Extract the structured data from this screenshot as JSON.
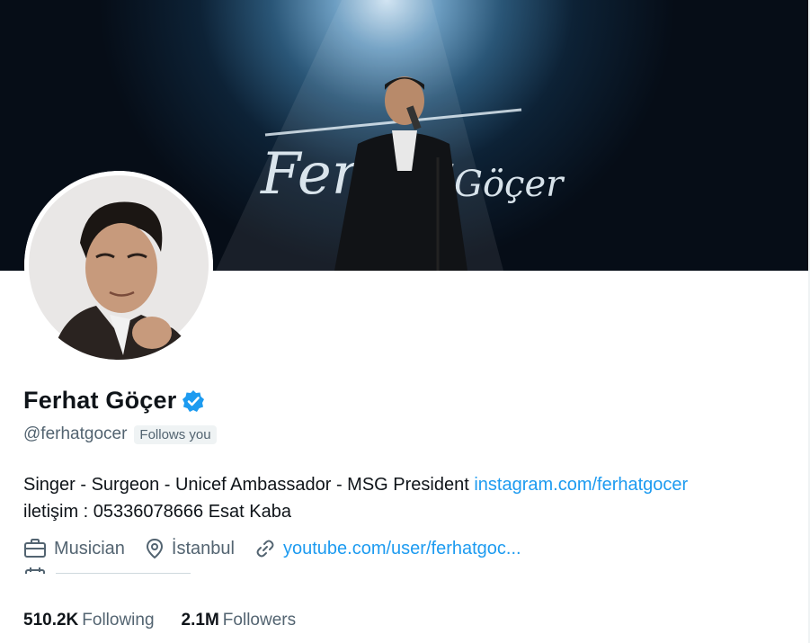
{
  "profile": {
    "name": "Ferhat Göçer",
    "handle": "@ferhatgocer",
    "follows_you": "Follows you",
    "banner_text_line1": "Ferhat",
    "banner_text_line2": "Göçer",
    "bio_text": "Singer - Surgeon - Unicef Ambassador - MSG President ",
    "bio_link": "instagram.com/ferhatgocer",
    "bio_line2": "iletişim : 05336078666 Esat Kaba",
    "profession": "Musician",
    "location": "İstanbul",
    "website": "youtube.com/user/ferhatgoc...",
    "following_count": "510.2K",
    "following_label": "Following",
    "followers_count": "2.1M",
    "followers_label": "Followers"
  },
  "icons": {
    "verified": "verified-badge-icon",
    "profession": "briefcase-icon",
    "location": "location-pin-icon",
    "website": "link-icon",
    "joined": "calendar-icon"
  },
  "colors": {
    "accent": "#1d9bf0",
    "secondary_text": "#536471",
    "primary_text": "#0f1419",
    "badge_bg": "#eff3f4"
  }
}
